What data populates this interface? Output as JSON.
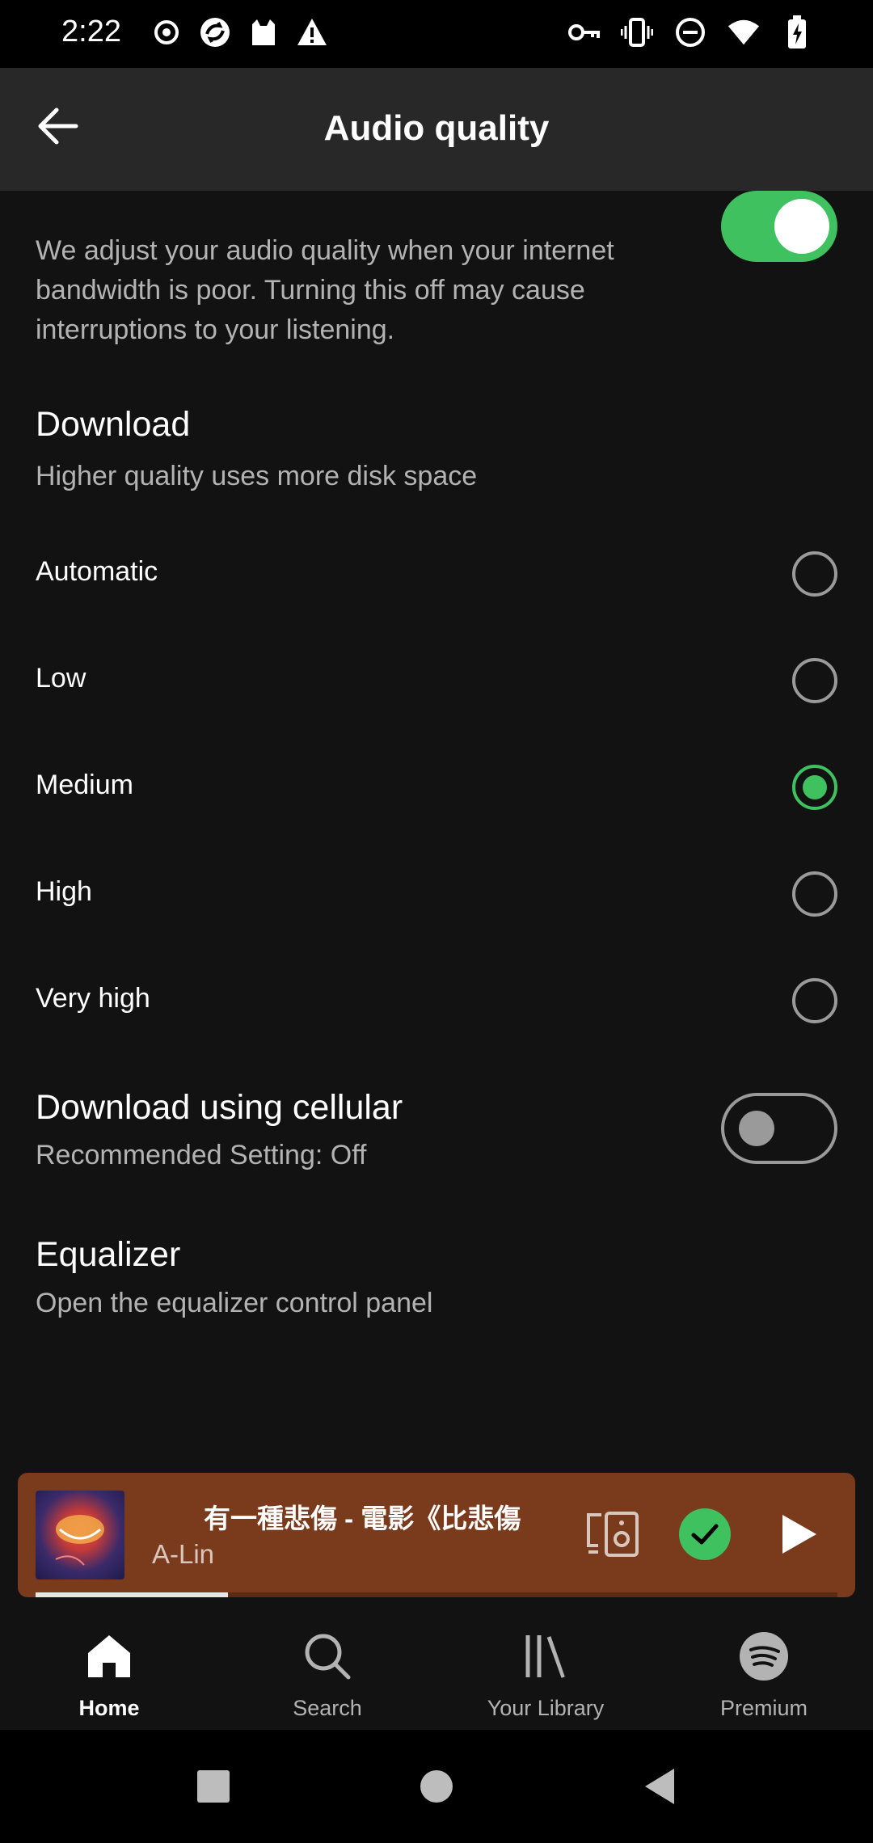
{
  "status_bar": {
    "time": "2:22",
    "left_icons": [
      "record-icon",
      "sync-icon",
      "cat-icon",
      "warning-icon"
    ],
    "right_icons": [
      "key-icon",
      "vibrate-icon",
      "dnd-icon",
      "wifi-icon",
      "battery-charging-icon"
    ]
  },
  "header": {
    "back_icon": "arrow-left-icon",
    "title": "Audio quality"
  },
  "auto_adjust": {
    "description": "We adjust your audio quality when your internet bandwidth is poor. Turning this off may cause interruptions to your listening.",
    "enabled": true
  },
  "download": {
    "title": "Download",
    "subtitle": "Higher quality uses more disk space",
    "options": [
      {
        "label": "Automatic",
        "selected": false
      },
      {
        "label": "Low",
        "selected": false
      },
      {
        "label": "Medium",
        "selected": true
      },
      {
        "label": "High",
        "selected": false
      },
      {
        "label": "Very high",
        "selected": false
      }
    ]
  },
  "cellular": {
    "title": "Download using cellular",
    "subtitle": "Recommended Setting: Off",
    "enabled": false
  },
  "equalizer": {
    "title": "Equalizer",
    "subtitle": "Open the equalizer control panel"
  },
  "now_playing": {
    "title": "有一種悲傷 - 電影《比悲傷",
    "artist": "A-Lin",
    "progress": 0.24,
    "background": "#7a3a1c"
  },
  "bottom_nav": {
    "items": [
      {
        "label": "Home",
        "icon": "home-icon",
        "active": true
      },
      {
        "label": "Search",
        "icon": "search-icon",
        "active": false
      },
      {
        "label": "Your Library",
        "icon": "library-icon",
        "active": false
      },
      {
        "label": "Premium",
        "icon": "spotify-icon",
        "active": false
      }
    ]
  },
  "colors": {
    "accent": "#3fc15f",
    "background": "#121212",
    "header": "#282828"
  }
}
